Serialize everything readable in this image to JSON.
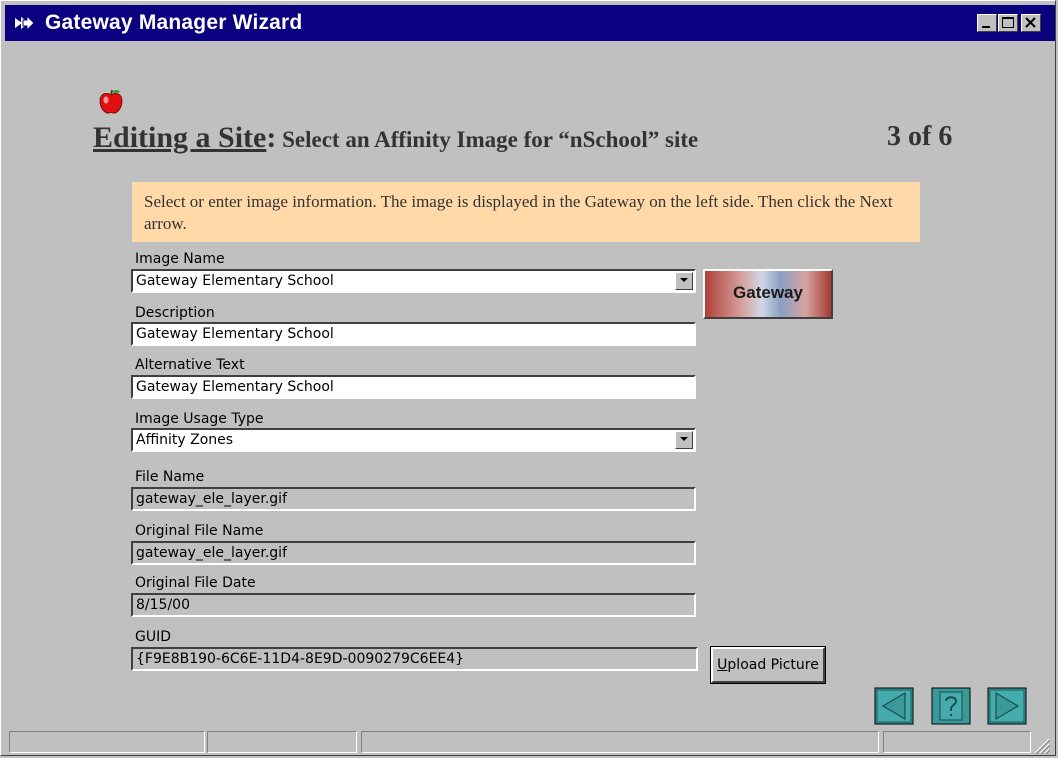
{
  "window": {
    "title": "Gateway Manager Wizard",
    "controls": [
      "minimize",
      "maximize",
      "close"
    ]
  },
  "heading": {
    "main": "Editing a Site",
    "colon": ":",
    "sub": " Select an Affinity Image for “nSchool” site",
    "step": "3 of 6"
  },
  "instructions": "Select or enter image information. The image is displayed in the Gateway on the left side. Then click the Next arrow.",
  "form": {
    "image_name": {
      "label": "Image Name",
      "value": "Gateway Elementary School"
    },
    "description": {
      "label": "Description",
      "value": "Gateway Elementary School"
    },
    "alt_text": {
      "label": "Alternative Text",
      "value": "Gateway Elementary School"
    },
    "usage_type": {
      "label": "Image Usage Type",
      "value": "Affinity Zones"
    },
    "file_name": {
      "label": "File Name",
      "value": "gateway_ele_layer.gif"
    },
    "orig_file_name": {
      "label": "Original File Name",
      "value": "gateway_ele_layer.gif"
    },
    "orig_file_date": {
      "label": "Original File Date",
      "value": "8/15/00"
    },
    "guid": {
      "label": "GUID",
      "value": "{F9E8B190-6C6E-11D4-8E9D-0090279C6EE4}"
    }
  },
  "preview": {
    "text": "Gateway"
  },
  "buttons": {
    "upload_prefix": "U",
    "upload_rest": "pload Picture"
  },
  "nav": {
    "back_icon": "arrow-left-icon",
    "help_icon": "question-icon",
    "next_icon": "arrow-right-icon",
    "color": "#3a9a9a"
  },
  "colors": {
    "titlebar": "#0a0080",
    "instruction_bg": "#ffd9a7"
  }
}
